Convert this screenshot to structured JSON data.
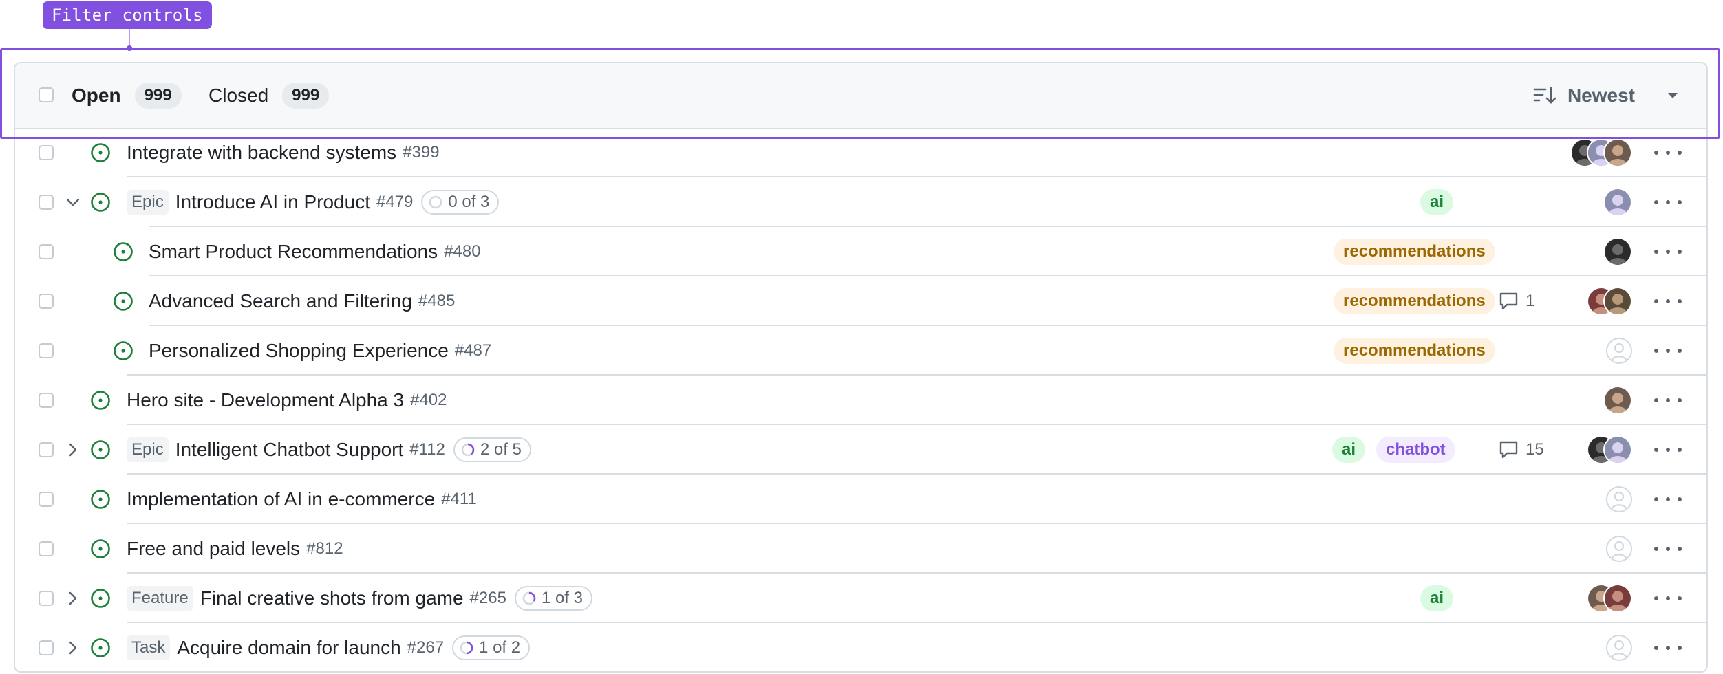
{
  "annotation": {
    "label": "Filter controls"
  },
  "header": {
    "open_label": "Open",
    "open_count": "999",
    "closed_label": "Closed",
    "closed_count": "999",
    "sort_label": "Newest",
    "icons": [
      "sort-icon",
      "caret-down-icon"
    ]
  },
  "colors": {
    "accent": "#8250df",
    "open_status": "#1a7f37",
    "label_ai_bg": "#dafbe1",
    "label_recommendations_bg": "#fff1e0",
    "label_chatbot_bg": "#f3ecff"
  },
  "rows": [
    {
      "title": "Integrate with backend systems",
      "number": "#399",
      "type": "",
      "progress": "",
      "labels": [],
      "comments": "",
      "assignees": 3
    },
    {
      "title": "Introduce AI in Product",
      "number": "#479",
      "type": "Epic",
      "progress": "0 of 3",
      "labels": [
        "ai"
      ],
      "comments": "",
      "assignees": 1,
      "expanded": true
    },
    {
      "title": "Smart Product Recommendations",
      "number": "#480",
      "type": "",
      "progress": "",
      "labels": [
        "recommendations"
      ],
      "comments": "",
      "assignees": 1,
      "child": true
    },
    {
      "title": "Advanced Search and Filtering",
      "number": "#485",
      "type": "",
      "progress": "",
      "labels": [
        "recommendations"
      ],
      "comments": "1",
      "assignees": 2,
      "child": true
    },
    {
      "title": "Personalized Shopping Experience",
      "number": "#487",
      "type": "",
      "progress": "",
      "labels": [
        "recommendations"
      ],
      "comments": "",
      "assignees": 0,
      "child": true
    },
    {
      "title": "Hero site - Development Alpha 3",
      "number": "#402",
      "type": "",
      "progress": "",
      "labels": [],
      "comments": "",
      "assignees": 1
    },
    {
      "title": "Intelligent Chatbot Support",
      "number": "#112",
      "type": "Epic",
      "progress": "2 of 5",
      "labels": [
        "ai",
        "chatbot"
      ],
      "comments": "15",
      "assignees": 2,
      "expanded": false
    },
    {
      "title": "Implementation of AI in e-commerce",
      "number": "#411",
      "type": "",
      "progress": "",
      "labels": [],
      "comments": "",
      "assignees": 0
    },
    {
      "title": "Free and paid levels",
      "number": "#812",
      "type": "",
      "progress": "",
      "labels": [],
      "comments": "",
      "assignees": 0
    },
    {
      "title": "Final creative shots from game",
      "number": "#265",
      "type": "Feature",
      "progress": "1 of 3",
      "labels": [
        "ai"
      ],
      "comments": "",
      "assignees": 2,
      "expanded": false
    },
    {
      "title": "Acquire domain for launch",
      "number": "#267",
      "type": "Task",
      "progress": "1 of 2",
      "labels": [],
      "comments": "",
      "assignees": 0,
      "expanded": false
    }
  ]
}
